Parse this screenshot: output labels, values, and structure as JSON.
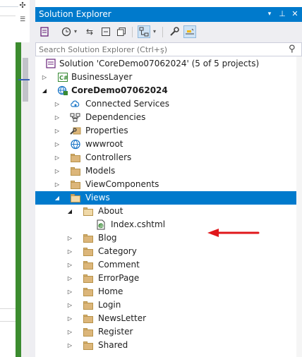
{
  "title_bar": {
    "title": "Solution Explorer",
    "dropdown_glyph": "▾",
    "pin_glyph": "⊥",
    "close_glyph": "✕"
  },
  "left_toolbar": {
    "icon1": "✣",
    "icon2": "☰"
  },
  "toolbar_icons": [
    "vs-solution-switch-icon",
    "history-icon",
    "sync-icon",
    "collapse-all-icon",
    "show-all-files-icon",
    "preview-selected-icon",
    "properties-wrench-icon",
    "highlight-active-icon"
  ],
  "search": {
    "placeholder": "Search Solution Explorer (Ctrl+ş)"
  },
  "tree": {
    "solution": "Solution 'CoreDemo07062024' (5 of 5 projects)",
    "nodes": [
      {
        "label": "BusinessLayer",
        "depth": 1,
        "expander": "collapsed",
        "icon": "csharp-project-icon"
      },
      {
        "label": "CoreDemo07062024",
        "depth": 1,
        "expander": "expanded",
        "icon": "web-project-icon",
        "bold": true
      },
      {
        "label": "Connected Services",
        "depth": 2,
        "expander": "collapsed",
        "icon": "connected-services-icon"
      },
      {
        "label": "Dependencies",
        "depth": 2,
        "expander": "collapsed",
        "icon": "dependencies-icon"
      },
      {
        "label": "Properties",
        "depth": 2,
        "expander": "collapsed",
        "icon": "properties-icon"
      },
      {
        "label": "wwwroot",
        "depth": 2,
        "expander": "collapsed",
        "icon": "globe-icon"
      },
      {
        "label": "Controllers",
        "depth": 2,
        "expander": "collapsed",
        "icon": "folder-icon"
      },
      {
        "label": "Models",
        "depth": 2,
        "expander": "collapsed",
        "icon": "folder-icon"
      },
      {
        "label": "ViewComponents",
        "depth": 2,
        "expander": "collapsed",
        "icon": "folder-icon"
      },
      {
        "label": "Views",
        "depth": 2,
        "expander": "expanded",
        "icon": "folder-open-icon",
        "selected": true
      },
      {
        "label": "About",
        "depth": 3,
        "expander": "expanded",
        "icon": "folder-open-icon"
      },
      {
        "label": "Index.cshtml",
        "depth": 4,
        "expander": "none",
        "icon": "razor-file-icon"
      },
      {
        "label": "Blog",
        "depth": 3,
        "expander": "collapsed",
        "icon": "folder-icon"
      },
      {
        "label": "Category",
        "depth": 3,
        "expander": "collapsed",
        "icon": "folder-icon"
      },
      {
        "label": "Comment",
        "depth": 3,
        "expander": "collapsed",
        "icon": "folder-icon"
      },
      {
        "label": "ErrorPage",
        "depth": 3,
        "expander": "collapsed",
        "icon": "folder-icon"
      },
      {
        "label": "Home",
        "depth": 3,
        "expander": "collapsed",
        "icon": "folder-icon"
      },
      {
        "label": "Login",
        "depth": 3,
        "expander": "collapsed",
        "icon": "folder-icon"
      },
      {
        "label": "NewsLetter",
        "depth": 3,
        "expander": "collapsed",
        "icon": "folder-icon"
      },
      {
        "label": "Register",
        "depth": 3,
        "expander": "collapsed",
        "icon": "folder-icon"
      },
      {
        "label": "Shared",
        "depth": 3,
        "expander": "collapsed",
        "icon": "folder-icon"
      }
    ]
  },
  "colors": {
    "accent": "#007acc",
    "folder": "#dcb67a",
    "annotation_arrow": "#e0171b",
    "gutter_green": "#3c8c2f"
  },
  "annotation": {
    "type": "red-arrow",
    "points_to": "Index.cshtml"
  }
}
